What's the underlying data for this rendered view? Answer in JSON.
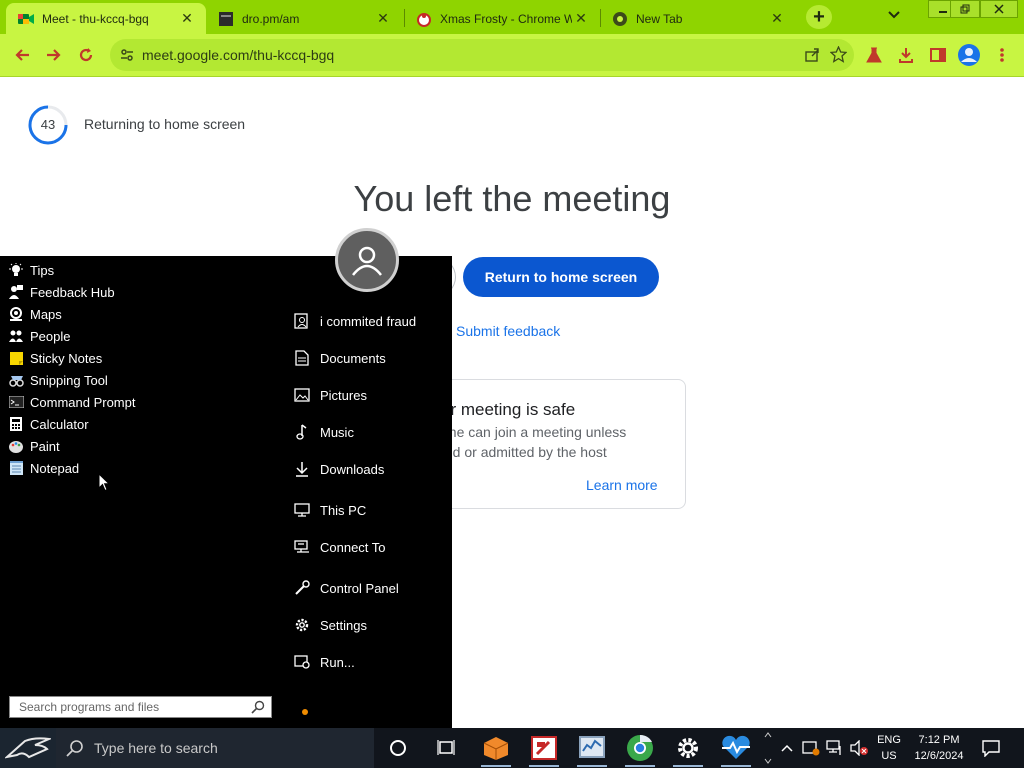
{
  "colors": {
    "tabstrip": "#8fd400",
    "toolbar": "#c8f542",
    "meet_blue": "#0b57d0",
    "link_blue": "#1a73e8",
    "taskbar": "#11151c",
    "start_menu": "#000000"
  },
  "tabs": [
    {
      "title": "Meet - thu-kccq-bgq",
      "icon": "meet-icon",
      "active": true
    },
    {
      "title": "dro.pm/am",
      "icon": "page-icon",
      "active": false
    },
    {
      "title": "Xmas Frosty - Chrome W",
      "icon": "frosty-icon",
      "active": false
    },
    {
      "title": "New Tab",
      "icon": "chrome-icon",
      "active": false
    }
  ],
  "new_tab_label": "+",
  "toolbar": {
    "url": "meet.google.com/thu-kccq-bgq"
  },
  "meet": {
    "countdown": "43",
    "returning_text": "Returning to home screen",
    "heading": "You left the meeting",
    "return_button": "Return to home screen",
    "submit_feedback": "Submit feedback",
    "safe_title": "ur meeting is safe",
    "safe_body_line1": "one can join a meeting unless",
    "safe_body_line2": "ted or admitted by the host",
    "learn_more": "Learn more"
  },
  "start_menu": {
    "apps": [
      {
        "label": "Tips",
        "icon": "lightbulb-icon"
      },
      {
        "label": "Feedback Hub",
        "icon": "feedback-hub-icon"
      },
      {
        "label": "Maps",
        "icon": "maps-icon"
      },
      {
        "label": "People",
        "icon": "people-icon"
      },
      {
        "label": "Sticky Notes",
        "icon": "sticky-notes-icon"
      },
      {
        "label": "Snipping Tool",
        "icon": "snipping-tool-icon"
      },
      {
        "label": "Command Prompt",
        "icon": "command-prompt-icon"
      },
      {
        "label": "Calculator",
        "icon": "calculator-icon"
      },
      {
        "label": "Paint",
        "icon": "paint-icon"
      },
      {
        "label": "Notepad",
        "icon": "notepad-icon"
      }
    ],
    "places": [
      {
        "label": "i commited fraud",
        "icon": "user-folder-icon"
      },
      {
        "label": "Documents",
        "icon": "documents-icon"
      },
      {
        "label": "Pictures",
        "icon": "pictures-icon"
      },
      {
        "label": "Music",
        "icon": "music-icon"
      },
      {
        "label": "Downloads",
        "icon": "downloads-icon"
      },
      {
        "label": "This PC",
        "icon": "this-pc-icon"
      },
      {
        "label": "Connect To",
        "icon": "connect-to-icon"
      },
      {
        "label": "Control Panel",
        "icon": "control-panel-icon"
      },
      {
        "label": "Settings",
        "icon": "settings-icon"
      },
      {
        "label": "Run...",
        "icon": "run-icon"
      }
    ],
    "search_placeholder": "Search programs and files"
  },
  "taskbar": {
    "search_placeholder": "Type here to search",
    "lang_line1": "ENG",
    "lang_line2": "US",
    "time": "7:12 PM",
    "date": "12/6/2024"
  }
}
